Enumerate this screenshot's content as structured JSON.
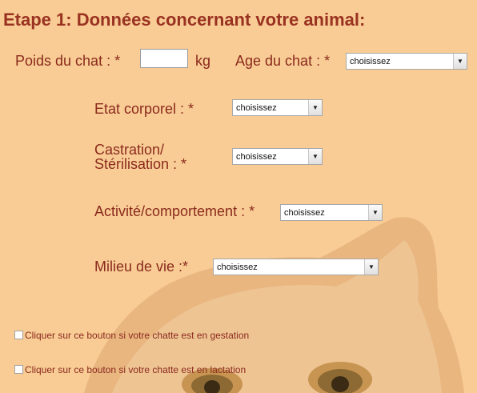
{
  "form": {
    "title": "Etape 1: Données concernant votre animal:",
    "weight": {
      "label": "Poids du chat : *",
      "value": "",
      "unit": "kg"
    },
    "age": {
      "label": "Age du chat : *",
      "selected": "choisissez"
    },
    "body_condition": {
      "label": "Etat corporel : *",
      "selected": "choisissez"
    },
    "castration": {
      "label_line1": "Castration/",
      "label_line2": "Stérilisation : *",
      "selected": "choisissez"
    },
    "activity": {
      "label": "Activité/comportement : *",
      "selected": "choisissez"
    },
    "environment": {
      "label": "Milieu de vie :*",
      "selected": "choisissez"
    },
    "gestation_checkbox": {
      "label": "Cliquer sur ce bouton si votre chatte est en gestation",
      "checked": false
    },
    "lactation_checkbox": {
      "label": "Cliquer sur ce bouton si votre chatte est en lactation",
      "checked": false
    }
  },
  "icons": {
    "dropdown_arrow": "▼"
  },
  "colors": {
    "background": "#f8cc94",
    "title": "#9a3222",
    "label": "#8b2a1e"
  }
}
